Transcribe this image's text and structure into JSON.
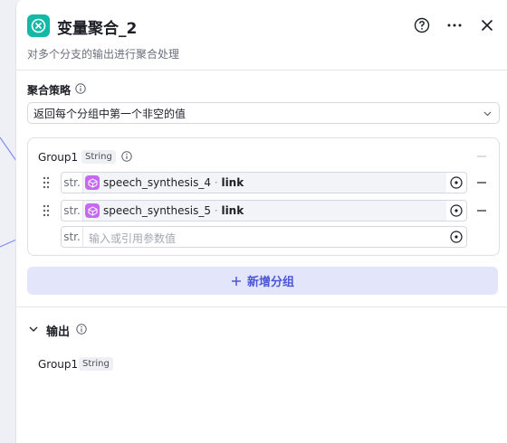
{
  "node": {
    "title": "变量聚合_2",
    "description": "对多个分支的输出进行聚合处理",
    "icon": "aggregate-icon",
    "icon_color": "#14b8a6"
  },
  "header_actions": {
    "help": "help-circle-icon",
    "more": "more-dots-icon",
    "close": "close-icon"
  },
  "strategy": {
    "label": "聚合策略",
    "selected": "返回每个分组中第一个非空的值"
  },
  "group": {
    "name": "Group1",
    "type": "String",
    "rows": [
      {
        "type_label": "str.",
        "ref_node": "speech_synthesis_4",
        "separator": "·",
        "ref_field": "link"
      },
      {
        "type_label": "str.",
        "ref_node": "speech_synthesis_5",
        "separator": "·",
        "ref_field": "link"
      }
    ],
    "empty_row": {
      "type_label": "str.",
      "placeholder": "输入或引用参数值"
    }
  },
  "add_group_label": "新增分组",
  "output": {
    "title": "输出",
    "item_name": "Group1",
    "item_type": "String"
  },
  "colors": {
    "accent": "#4c57d6",
    "accent_bg": "#e3e6fb",
    "ref_icon": "#c56af0"
  }
}
